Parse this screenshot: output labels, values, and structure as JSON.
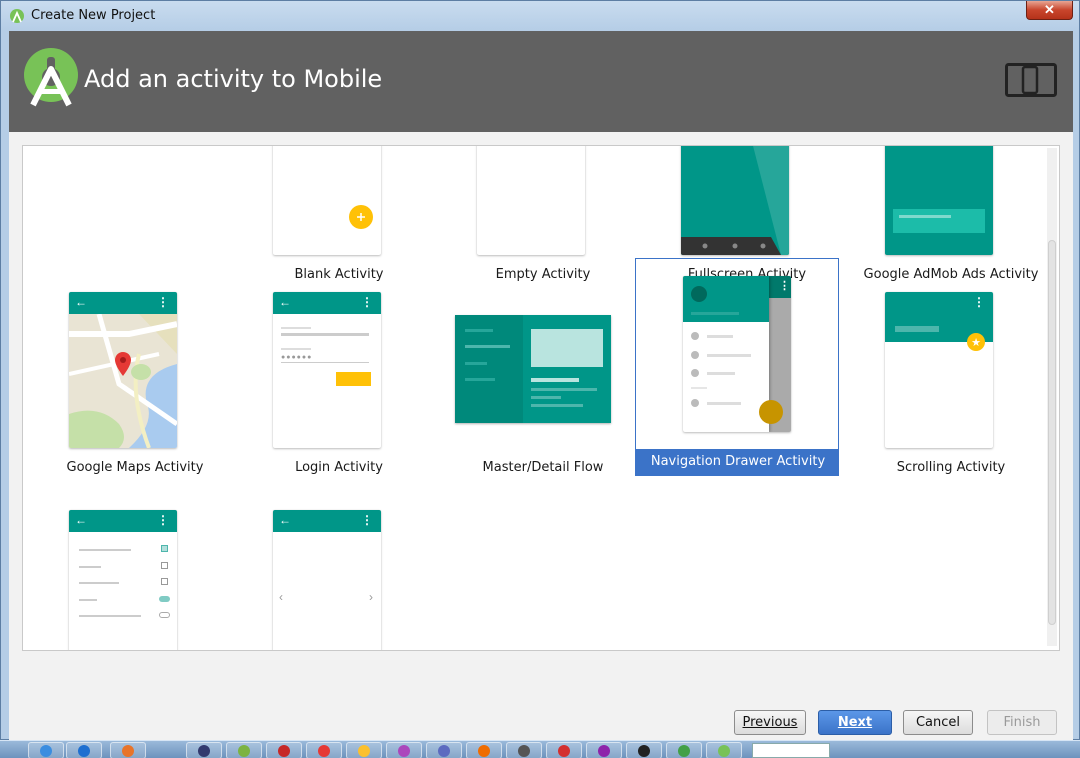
{
  "window": {
    "title": "Create New Project",
    "close_label": "✕"
  },
  "header": {
    "heading": "Add an activity to Mobile"
  },
  "gallery": {
    "row1": [
      {
        "label": "Blank Activity"
      },
      {
        "label": "Empty Activity"
      },
      {
        "label": "Fullscreen Activity"
      },
      {
        "label": "Google AdMob Ads Activity"
      }
    ],
    "row2": [
      {
        "label": "Google Maps Activity"
      },
      {
        "label": "Login Activity"
      },
      {
        "label": "Master/Detail Flow"
      },
      {
        "label": "Navigation Drawer Activity",
        "selected": true
      },
      {
        "label": "Scrolling Activity"
      }
    ],
    "row3": [
      {
        "label": ""
      },
      {
        "label": ""
      }
    ]
  },
  "footer": {
    "previous_label": "Previous",
    "next_label": "Next",
    "cancel_label": "Cancel",
    "finish_label": "Finish"
  },
  "colors": {
    "accent": "#009688",
    "selection": "#3b73c8",
    "fab": "#ffc107",
    "header_bg": "#616161"
  },
  "icons": [
    "android-studio-icon",
    "device-icon",
    "back-arrow-icon",
    "overflow-menu-icon",
    "fab-plus-icon",
    "map-pin-icon",
    "star-icon"
  ]
}
